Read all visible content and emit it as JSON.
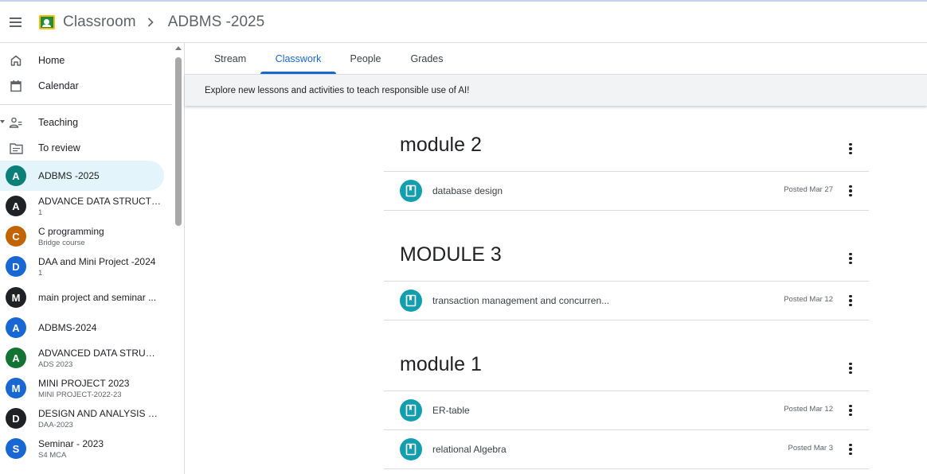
{
  "header": {
    "app_title": "Classroom",
    "course_title": "ADBMS -2025"
  },
  "sidebar": {
    "nav": [
      {
        "label": "Home",
        "icon": "home-icon"
      },
      {
        "label": "Calendar",
        "icon": "calendar-icon"
      },
      {
        "label": "Teaching",
        "icon": "people-icon"
      },
      {
        "label": "To review",
        "icon": "folder-review-icon"
      }
    ],
    "courses": [
      {
        "letter": "A",
        "name": "ADBMS -2025",
        "sub": "",
        "color": "#0b8079",
        "selected": true
      },
      {
        "letter": "A",
        "name": "ADVANCE DATA STRUCTU...",
        "sub": "1",
        "color": "#202124"
      },
      {
        "letter": "C",
        "name": "C programming",
        "sub": "Bridge course",
        "color": "#c26401"
      },
      {
        "letter": "D",
        "name": "DAA and Mini Project -2024",
        "sub": "1",
        "color": "#1967d2"
      },
      {
        "letter": "M",
        "name": "main project and seminar ...",
        "sub": "",
        "color": "#202124"
      },
      {
        "letter": "A",
        "name": "ADBMS-2024",
        "sub": "",
        "color": "#1967d2"
      },
      {
        "letter": "A",
        "name": "ADVANCED DATA STRUCT...",
        "sub": "ADS 2023",
        "color": "#137333"
      },
      {
        "letter": "M",
        "name": "MINI PROJECT 2023",
        "sub": "MINI PROJECT-2022-23",
        "color": "#1967d2"
      },
      {
        "letter": "D",
        "name": "DESIGN AND ANALYSIS O...",
        "sub": "DAA-2023",
        "color": "#202124"
      },
      {
        "letter": "S",
        "name": "Seminar - 2023",
        "sub": "S4 MCA",
        "color": "#1967d2"
      }
    ]
  },
  "tabs": [
    "Stream",
    "Classwork",
    "People",
    "Grades"
  ],
  "active_tab": "Classwork",
  "banner": "Explore new lessons and activities to teach responsible use of AI!",
  "topics": [
    {
      "title": "module 2",
      "items": [
        {
          "title": "database design",
          "date": "Posted Mar 27"
        }
      ]
    },
    {
      "title": "MODULE 3",
      "items": [
        {
          "title": "transaction management and concurren...",
          "date": "Posted Mar 12"
        }
      ]
    },
    {
      "title": "module 1",
      "items": [
        {
          "title": "ER-table",
          "date": "Posted Mar 12"
        },
        {
          "title": "relational Algebra",
          "date": "Posted Mar 3"
        }
      ]
    }
  ],
  "colors": {
    "accent": "#1967d2",
    "material_icon": "#129eaf",
    "selected_bg": "#e3f5fa"
  }
}
